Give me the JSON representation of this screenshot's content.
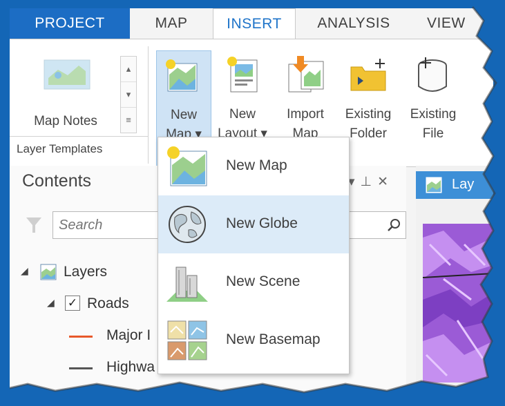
{
  "tabs": [
    "PROJECT",
    "MAP",
    "INSERT",
    "ANALYSIS",
    "VIEW"
  ],
  "ribbon": {
    "map_notes_label": "Map Notes",
    "group_label": "Layer Templates",
    "buttons": [
      {
        "line1": "New",
        "line2": "Map ▾"
      },
      {
        "line1": "New",
        "line2": "Layout ▾"
      },
      {
        "line1": "Import",
        "line2": "Map"
      },
      {
        "line1": "Existing",
        "line2": "Folder"
      },
      {
        "line1": "Existing",
        "line2": "File"
      }
    ]
  },
  "contents": {
    "title": "Contents",
    "search_placeholder": "Search",
    "tree": [
      {
        "label": "Layers"
      },
      {
        "label": "Roads"
      },
      {
        "label": "Major I"
      },
      {
        "label": "Highwa"
      }
    ]
  },
  "map_view": {
    "tab_label": "Lay"
  },
  "dropdown": {
    "items": [
      {
        "label": "New Map",
        "icon": "new-map-icon"
      },
      {
        "label": "New Globe",
        "icon": "new-globe-icon",
        "highlighted": true
      },
      {
        "label": "New Scene",
        "icon": "new-scene-icon"
      },
      {
        "label": "New Basemap",
        "icon": "new-basemap-icon"
      }
    ]
  },
  "colors": {
    "accent": "#1c6dc4",
    "highlight": "#dcebf8",
    "major_road": "#e8582a",
    "highway": "#555555"
  }
}
